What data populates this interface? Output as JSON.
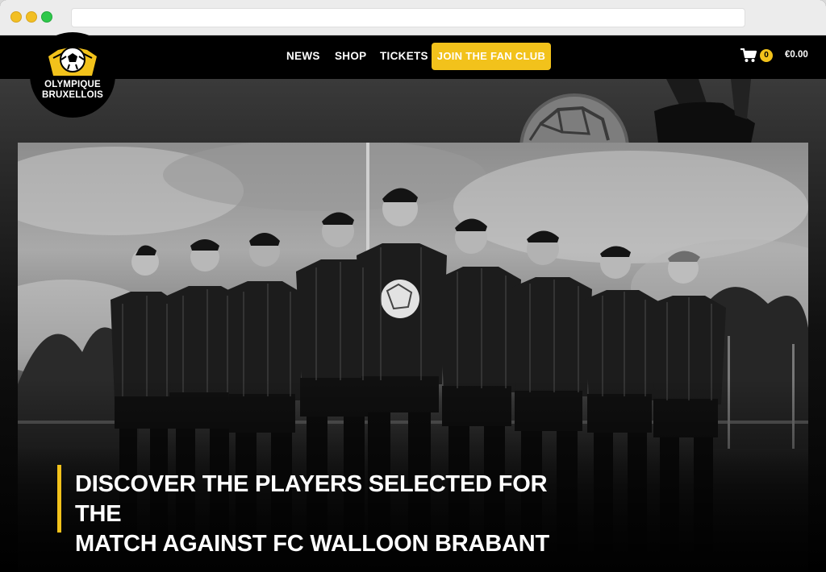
{
  "site": {
    "logo": {
      "line1": "OLYMPIQUE",
      "line2": "BRUXELLOIS"
    },
    "nav": {
      "news": "NEWS",
      "shop": "SHOP",
      "tickets": "TICKETS",
      "fan_club": "JOIN THE FAN CLUB"
    },
    "cart": {
      "count": "0",
      "total": "€0.00",
      "icon": "cart-icon"
    }
  },
  "hero": {
    "headline_line1": "DISCOVER THE PLAYERS SELECTED FOR THE",
    "headline_line2": "MATCH AGAINST FC WALLOON BRABANT"
  },
  "colors": {
    "accent": "#f2c21b",
    "background": "#000000",
    "text": "#ffffff"
  }
}
